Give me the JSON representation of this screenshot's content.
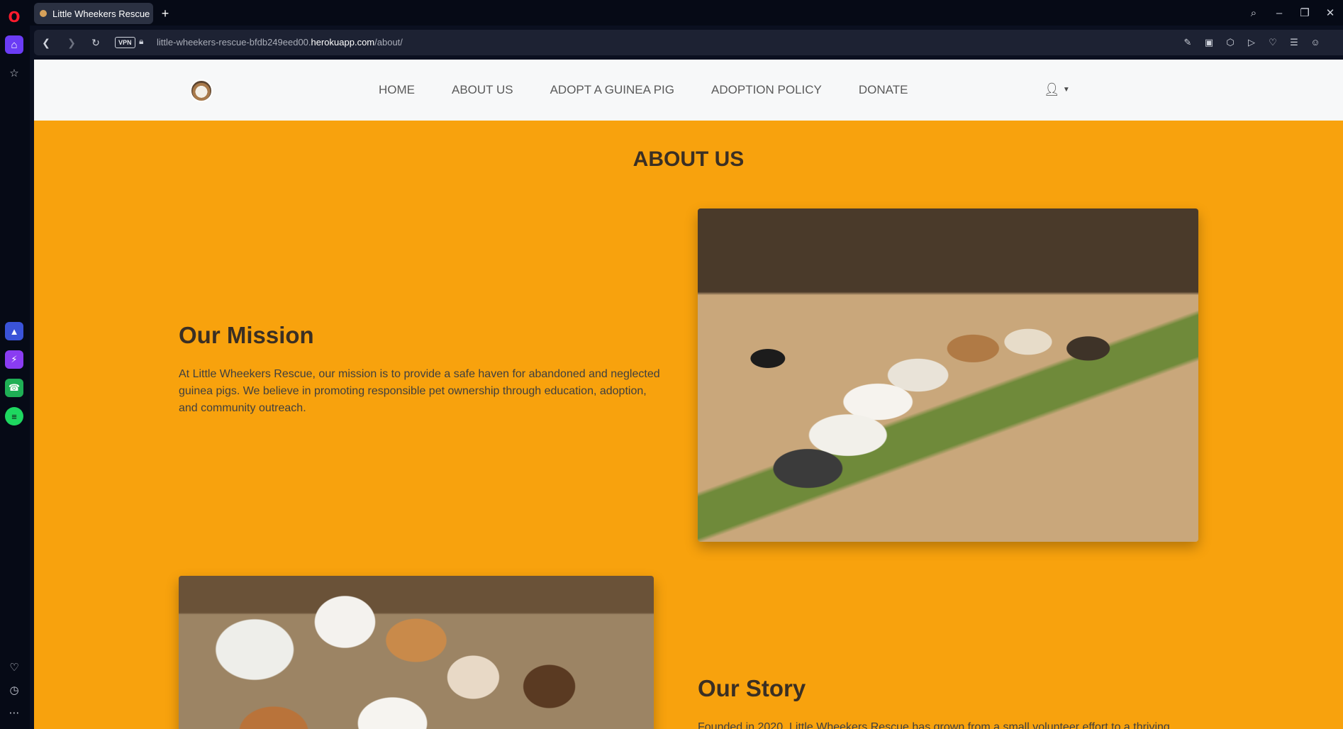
{
  "browser": {
    "tab_title": "Little Wheekers Rescue",
    "new_tab": "+",
    "vpn": "VPN",
    "url_prefix": "little-wheekers-rescue-bfdb249eed00.",
    "url_host": "herokuapp.com",
    "url_path": "/about/",
    "window_controls": [
      "search-icon",
      "minimize-icon",
      "restore-icon",
      "close-icon"
    ],
    "toolbar_icons": [
      "edit-icon",
      "camera-icon",
      "shield-icon",
      "play-icon",
      "heart-icon",
      "menu-icon",
      "profile-icon"
    ]
  },
  "sidebar": {
    "items": [
      "home-icon",
      "star-icon",
      "aria-icon",
      "messenger-icon",
      "whatsapp-icon",
      "spotify-icon",
      "heart-icon",
      "history-icon",
      "more-icon"
    ]
  },
  "nav": {
    "links": [
      "HOME",
      "ABOUT US",
      "ADOPT A GUINEA PIG",
      "ADOPTION POLICY",
      "DONATE"
    ]
  },
  "page": {
    "heading": "ABOUT US",
    "mission": {
      "title": "Our Mission",
      "body": "At Little Wheekers Rescue, our mission is to provide a safe haven for abandoned and neglected guinea pigs. We believe in promoting responsible pet ownership through education, adoption, and community outreach."
    },
    "story": {
      "title": "Our Story",
      "body": "Founded in 2020, Little Wheekers Rescue has grown from a small volunteer effort to a thriving"
    }
  }
}
